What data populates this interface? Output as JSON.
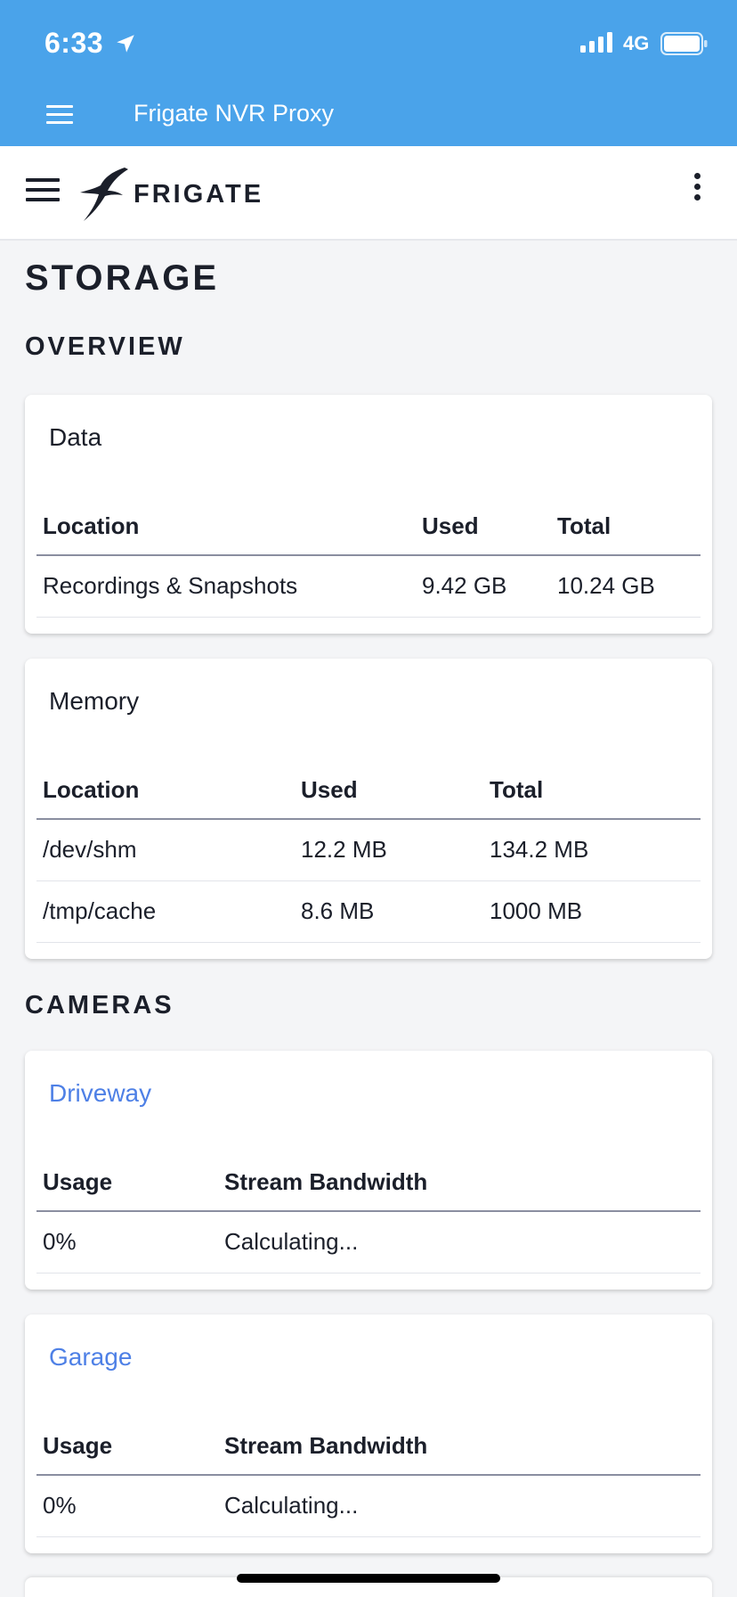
{
  "status_bar": {
    "time": "6:33",
    "network": "4G"
  },
  "ha_header": {
    "title": "Frigate NVR Proxy"
  },
  "app_bar": {
    "brand": "FRIGATE"
  },
  "page": {
    "title": "STORAGE"
  },
  "overview": {
    "heading": "OVERVIEW",
    "data_card": {
      "title": "Data",
      "headers": [
        "Location",
        "Used",
        "Total"
      ],
      "rows": [
        [
          "Recordings & Snapshots",
          "9.42 GB",
          "10.24 GB"
        ]
      ]
    },
    "memory_card": {
      "title": "Memory",
      "headers": [
        "Location",
        "Used",
        "Total"
      ],
      "rows": [
        [
          "/dev/shm",
          "12.2 MB",
          "134.2 MB"
        ],
        [
          "/tmp/cache",
          "8.6 MB",
          "1000 MB"
        ]
      ]
    }
  },
  "cameras": {
    "heading": "CAMERAS",
    "items": [
      {
        "name": "Driveway",
        "headers": [
          "Usage",
          "Stream Bandwidth"
        ],
        "row": [
          "0%",
          "Calculating..."
        ]
      },
      {
        "name": "Garage",
        "headers": [
          "Usage",
          "Stream Bandwidth"
        ],
        "row": [
          "0%",
          "Calculating..."
        ]
      }
    ]
  },
  "colors": {
    "header_blue": "#4aa3ea",
    "link_blue": "#4e80e6",
    "text": "#1b1f2a"
  }
}
